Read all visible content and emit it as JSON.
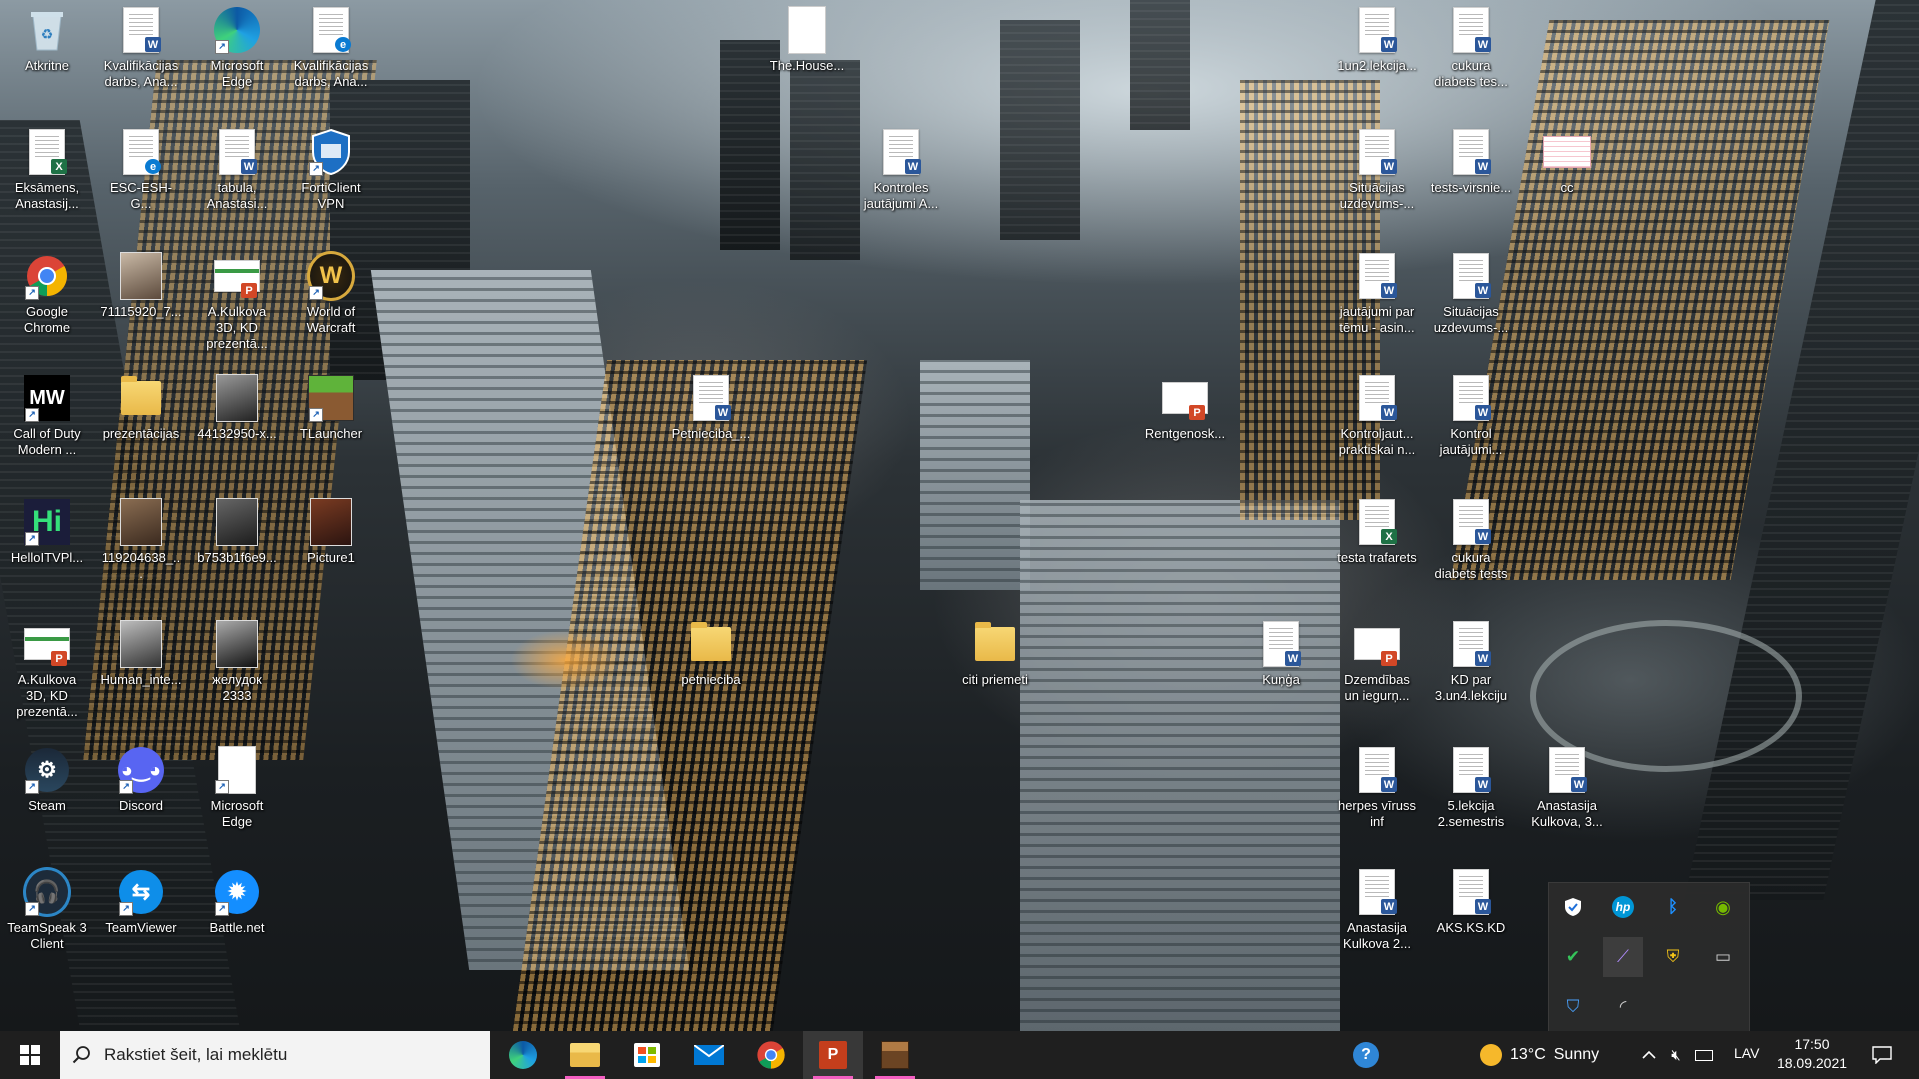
{
  "desktop": {
    "icons": [
      {
        "label": "Atkritne"
      },
      {
        "label": "Kvalifikācijas darbs, Ana..."
      },
      {
        "label": "Microsoft Edge"
      },
      {
        "label": "Kvalifikācijas darbs, Ana..."
      },
      {
        "label": "Eksāmens, Anastasij..."
      },
      {
        "label": "ESC-ESH-G..."
      },
      {
        "label": "tabula, Anastasi..."
      },
      {
        "label": "FortiClient VPN"
      },
      {
        "label": "Google Chrome"
      },
      {
        "label": "71115920_7..."
      },
      {
        "label": "A.Kulkova 3D, KD prezentā..."
      },
      {
        "label": "World of Warcraft"
      },
      {
        "label": "Call of Duty Modern ..."
      },
      {
        "label": "prezentācijas"
      },
      {
        "label": "44132950-x..."
      },
      {
        "label": "TLauncher"
      },
      {
        "label": "HelloITVPl..."
      },
      {
        "label": "119204638_..."
      },
      {
        "label": "b753b1f6e9..."
      },
      {
        "label": "Picture1"
      },
      {
        "label": "A.Kulkova 3D, KD prezentā..."
      },
      {
        "label": "Human_inte..."
      },
      {
        "label": "желудок 2333"
      },
      {
        "label": "Steam"
      },
      {
        "label": "Discord"
      },
      {
        "label": "Microsoft Edge"
      },
      {
        "label": "TeamSpeak 3 Client"
      },
      {
        "label": "TeamViewer"
      },
      {
        "label": "Battle.net"
      },
      {
        "label": "The.House..."
      },
      {
        "label": "Kontroles jautājumi A..."
      },
      {
        "label": "Petnieciba_..."
      },
      {
        "label": "petnieciba"
      },
      {
        "label": "citi priemeti"
      },
      {
        "label": "Rentgenosk..."
      },
      {
        "label": "Kuņģa"
      },
      {
        "label": "1un2.lekcija..."
      },
      {
        "label": "cukura diabets tes..."
      },
      {
        "label": "Situācijas uzdevums-..."
      },
      {
        "label": "tests-virsnie..."
      },
      {
        "label": "cc"
      },
      {
        "label": "jautājumi par tēmu - asin..."
      },
      {
        "label": "Situācijas uzdevums-..."
      },
      {
        "label": "Kontroljaut... praktiskai n..."
      },
      {
        "label": "Kontrol jautājumi..."
      },
      {
        "label": "testa trafarets"
      },
      {
        "label": "cukura diabets tests"
      },
      {
        "label": "Dzemdības un iegurņ..."
      },
      {
        "label": "KD par 3.un4.lekciju"
      },
      {
        "label": "herpes vīruss inf"
      },
      {
        "label": "5.lekcija 2.semestris"
      },
      {
        "label": "Anastasija Kulkova, 3..."
      },
      {
        "label": "Anastasija Kulkova 2..."
      },
      {
        "label": "AKS.KS.KD"
      }
    ]
  },
  "taskbar": {
    "search_placeholder": "Rakstiet šeit, lai meklētu",
    "pinned": [
      "edge-icon",
      "file-explorer-icon",
      "store-icon",
      "mail-icon",
      "chrome-icon",
      "powerpoint-icon",
      "minecraft-icon"
    ],
    "weather": {
      "temp": "13°C",
      "condition": "Sunny"
    },
    "language": "LAV",
    "time": "17:50",
    "date": "18.09.2021"
  },
  "tray_popup": {
    "icons": [
      "defender-icon",
      "hp-icon",
      "bluetooth-icon",
      "nvidia-icon",
      "security-check-icon",
      "pen-icon",
      "shield-icon",
      "monitor-icon",
      "forticlient-icon",
      "wifi-icon"
    ]
  }
}
